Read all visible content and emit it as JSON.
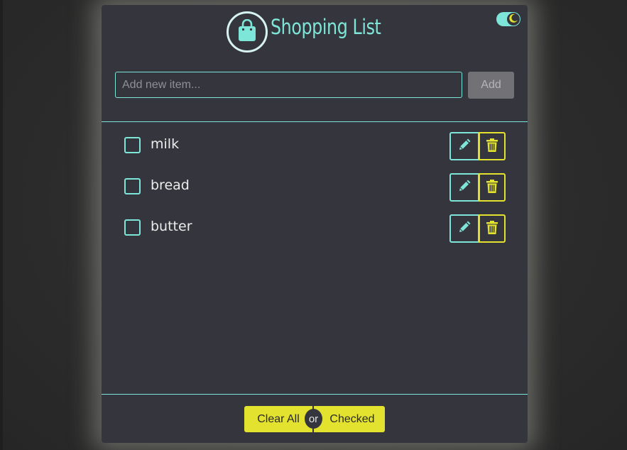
{
  "header": {
    "title": "Shopping List",
    "logo_icon": "shopping-bag-icon",
    "theme_toggle_icon": "moon-icon",
    "theme_toggle_on": true
  },
  "add_form": {
    "placeholder": "Add new item...",
    "value": "",
    "button_label": "Add"
  },
  "items": [
    {
      "label": "milk",
      "checked": false
    },
    {
      "label": "bread",
      "checked": false
    },
    {
      "label": "butter",
      "checked": false
    }
  ],
  "item_actions": {
    "edit_icon": "pencil-icon",
    "delete_icon": "trash-icon"
  },
  "footer": {
    "clear_all_label": "Clear All",
    "or_label": "or",
    "clear_checked_label": "Checked"
  },
  "colors": {
    "accent": "#7ee6d8",
    "warning": "#e3e22e",
    "card_bg": "#35353d"
  }
}
